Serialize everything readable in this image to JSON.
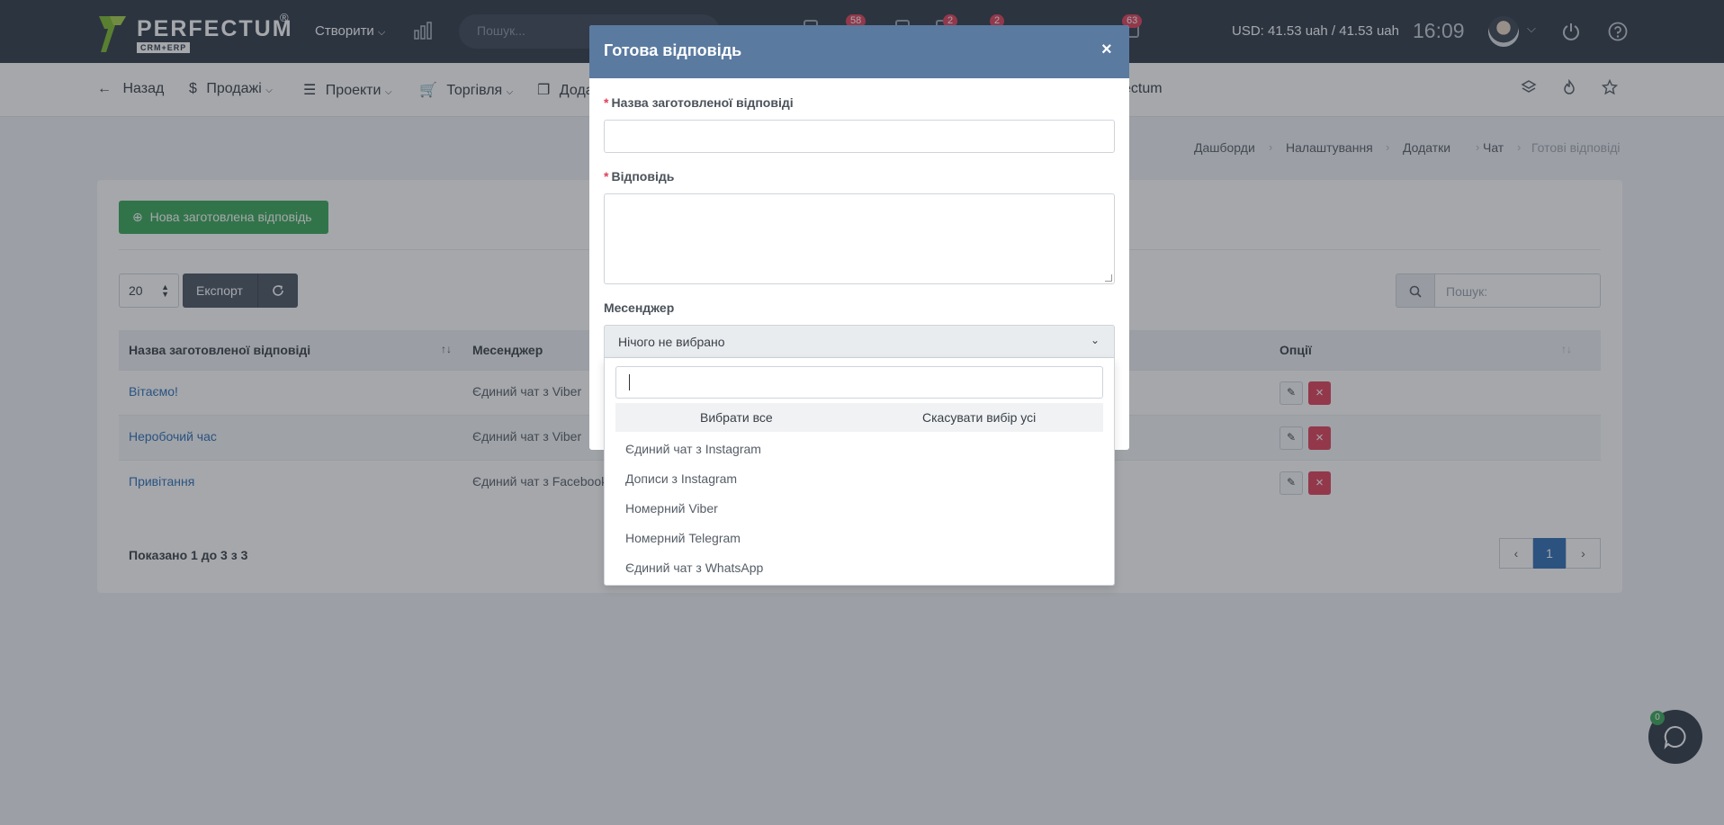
{
  "topbar": {
    "logo_name": "PERFECTUM",
    "logo_reg": "®",
    "logo_sub": "CRM+ERP",
    "create_label": "Створити",
    "search_placeholder": "Пошук...",
    "badges": [
      "58",
      "2",
      "2",
      "63"
    ],
    "currency": "USD: 41.53 uah / 41.53 uah",
    "time": "16:09"
  },
  "subnav": {
    "back": "Назад",
    "sales": "Продажі",
    "projects": "Проекти",
    "trade": "Торгівля",
    "addons_partial": "Дода",
    "perfectum_partial": "ectum"
  },
  "breadcrumb": [
    "Дашборди",
    "Налаштування",
    "Додатки",
    "Чат",
    "Готові відповіді"
  ],
  "page": {
    "new_button": "Нова заготовлена відповідь",
    "page_size": "20",
    "export": "Експорт",
    "search_placeholder": "Пошук:",
    "columns": {
      "name": "Назва заготовленої відповіді",
      "messenger": "Месенджер",
      "options": "Опції"
    },
    "rows": [
      {
        "name": "Вітаємо!",
        "messenger": "Єдиний чат з Viber"
      },
      {
        "name": "Неробочий час",
        "messenger": "Єдиний чат з Viber"
      },
      {
        "name": "Привітання",
        "messenger": "Єдиний чат з Facebook"
      }
    ],
    "shown": "Показано 1 до 3 з 3",
    "current_page": "1"
  },
  "chat_widget": {
    "count": "0"
  },
  "modal": {
    "title": "Готова відповідь",
    "close": "×",
    "name_label": "Назва заготовленої відповіді",
    "answer_label": "Відповідь",
    "messenger_label": "Месенджер",
    "select_value": "Нічого не вибрано",
    "required_mark": "*",
    "dropdown": {
      "select_all": "Вибрати все",
      "deselect_all": "Скасувати вибір усі",
      "options": [
        "Єдиний чат з Instagram",
        "Дописи з Instagram",
        "Номерний Viber",
        "Номерний Telegram",
        "Єдиний чат з WhatsApp"
      ]
    }
  },
  "colors": {
    "topbar": "#2f3a47",
    "accent_green": "#3aa856",
    "modal_header": "#5a7aa0",
    "danger": "#e0415a",
    "link": "#2c6fb7"
  }
}
